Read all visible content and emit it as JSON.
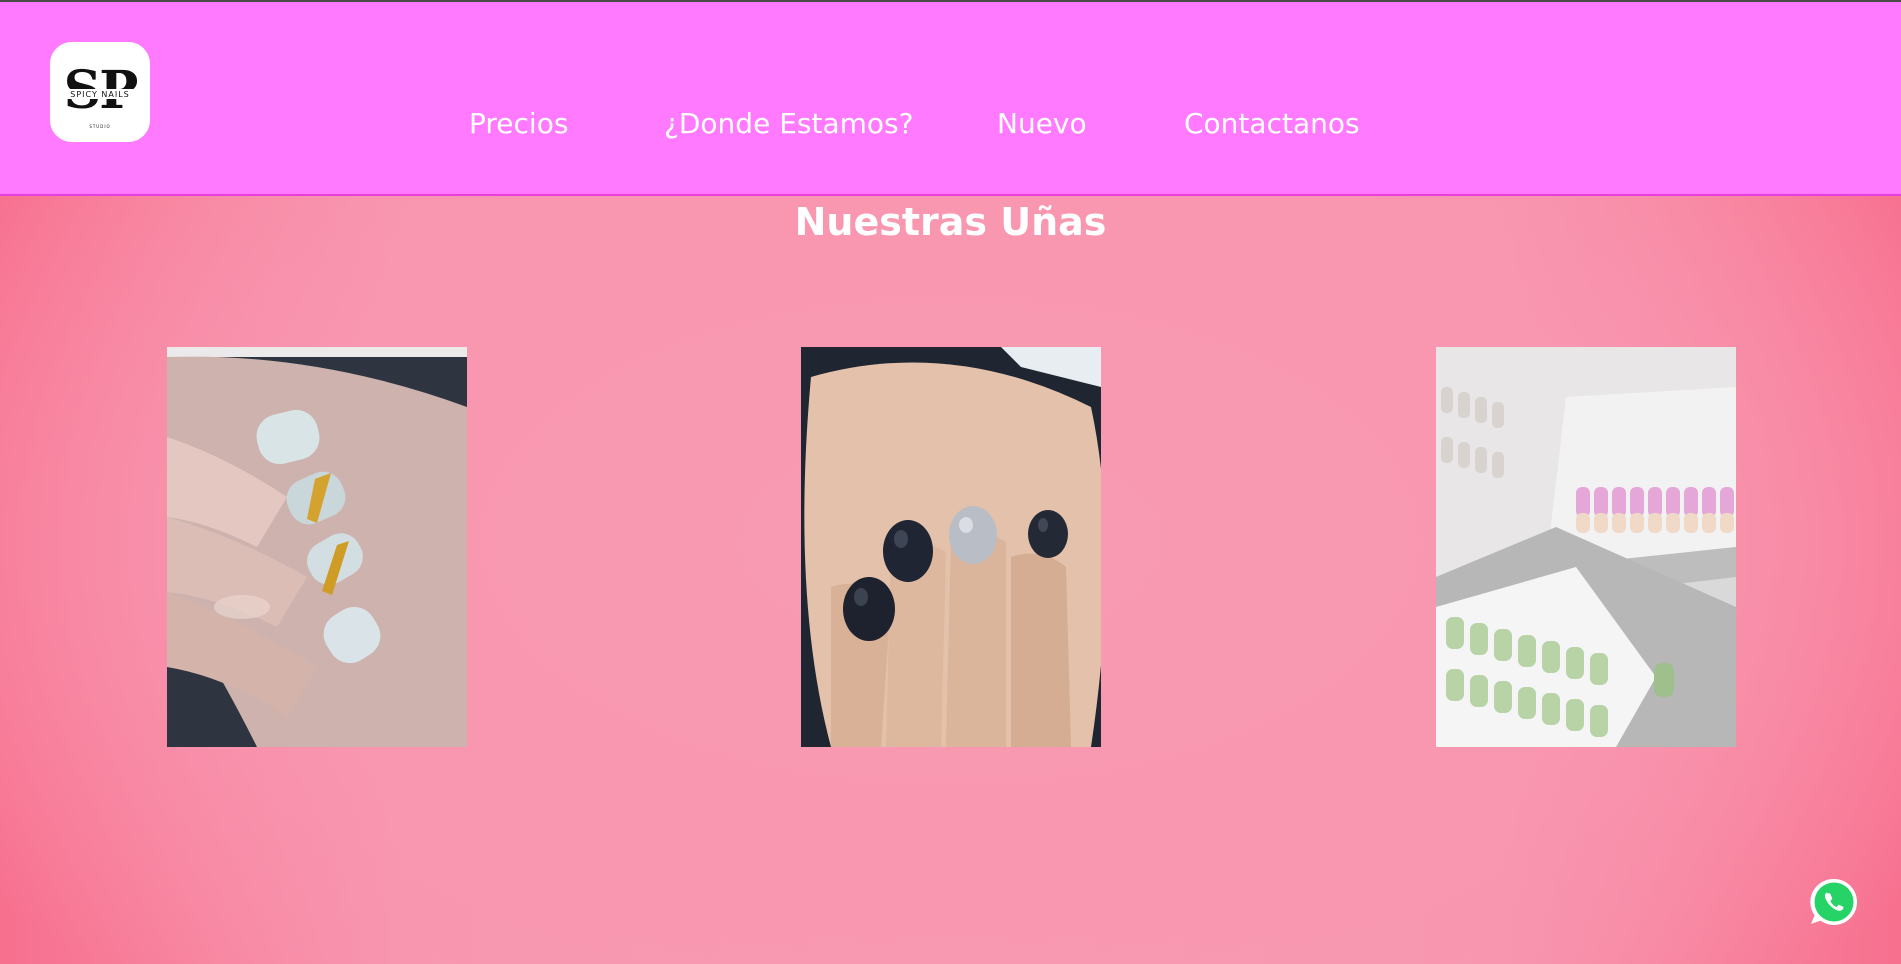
{
  "header": {
    "brand_logo_text": "SP",
    "brand_logo_subtitle": "SPICY NAILS",
    "brand_logo_tagline": "STUDIO",
    "nav": [
      {
        "label": "Precios"
      },
      {
        "label": "¿Donde Estamos?"
      },
      {
        "label": "Nuevo"
      },
      {
        "label": "Contactanos"
      }
    ]
  },
  "main": {
    "title": "Nuestras Uñas",
    "gallery": [
      {
        "subject": "white square nails with gold glitter stripe"
      },
      {
        "subject": "short black and silver glitter nails"
      },
      {
        "subject": "press-on nail sets in pink and green"
      }
    ]
  },
  "floating": {
    "whatsapp_icon": "whatsapp-icon"
  },
  "colors": {
    "header_bg": "#ff7aff",
    "page_bg": "#f894b0",
    "nav_text": "#ffffff",
    "whatsapp_green": "#25d366"
  }
}
